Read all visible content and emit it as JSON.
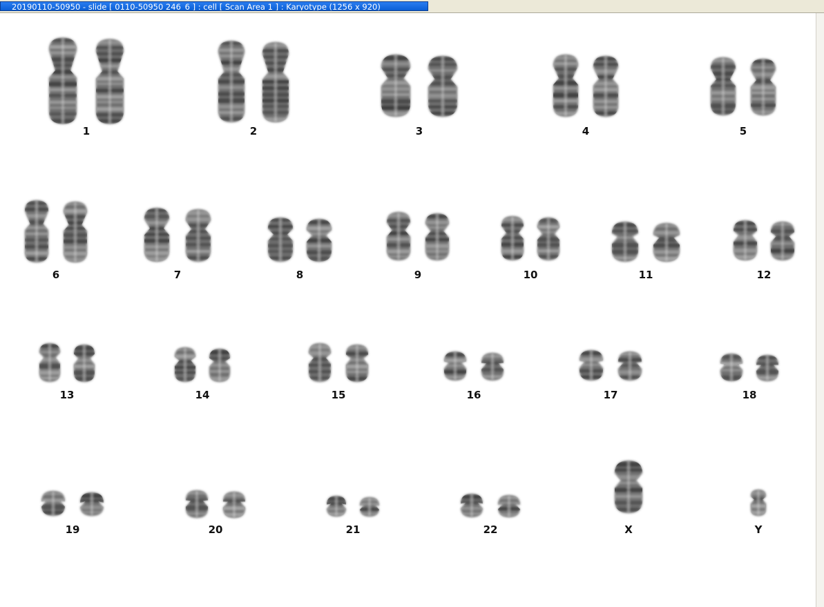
{
  "window": {
    "title": "20190110-50950 - slide [ 0110-50950 246_6 ] : cell [ Scan Area 1 ] : Karyotype  (1256 x 920)"
  },
  "chromosomes": [
    {
      "label": "1"
    },
    {
      "label": "2"
    },
    {
      "label": "3"
    },
    {
      "label": "4"
    },
    {
      "label": "5"
    },
    {
      "label": "6"
    },
    {
      "label": "7"
    },
    {
      "label": "8"
    },
    {
      "label": "9"
    },
    {
      "label": "10"
    },
    {
      "label": "11"
    },
    {
      "label": "12"
    },
    {
      "label": "13"
    },
    {
      "label": "14"
    },
    {
      "label": "15"
    },
    {
      "label": "16"
    },
    {
      "label": "17"
    },
    {
      "label": "18"
    },
    {
      "label": "19"
    },
    {
      "label": "20"
    },
    {
      "label": "21"
    },
    {
      "label": "22"
    },
    {
      "label": "X"
    },
    {
      "label": "Y"
    }
  ],
  "colors": {
    "chromatin_dark": "#3a3a3a",
    "chromatin_mid": "#6e6e6e",
    "chromatin_light": "#a8a8a8",
    "title_bar": "#0a5fd6"
  }
}
